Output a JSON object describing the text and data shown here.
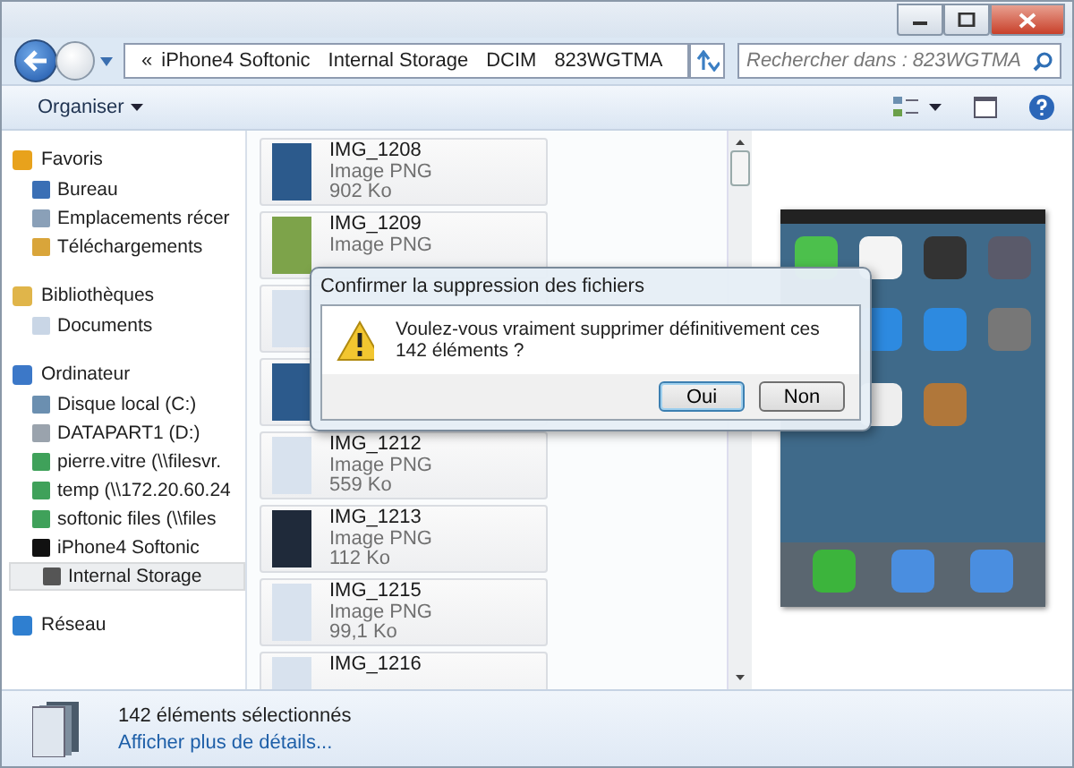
{
  "address_bar": {
    "overflow_marker": "«",
    "breadcrumb": [
      "iPhone4 Softonic",
      "Internal Storage",
      "DCIM",
      "823WGTMA"
    ]
  },
  "search": {
    "placeholder": "Rechercher dans : 823WGTMA"
  },
  "toolbar": {
    "organize": "Organiser"
  },
  "sidebar": {
    "groups": [
      {
        "label": "Favoris",
        "items": [
          {
            "label": "Bureau",
            "selected": false
          },
          {
            "label": "Emplacements récer",
            "selected": false
          },
          {
            "label": "Téléchargements",
            "selected": false
          }
        ]
      },
      {
        "label": "Bibliothèques",
        "items": [
          {
            "label": "Documents",
            "selected": false
          }
        ]
      },
      {
        "label": "Ordinateur",
        "items": [
          {
            "label": "Disque local (C:)",
            "selected": false
          },
          {
            "label": "DATAPART1 (D:)",
            "selected": false
          },
          {
            "label": "pierre.vitre (\\\\filesvr.",
            "selected": false
          },
          {
            "label": "temp (\\\\172.20.60.24",
            "selected": false
          },
          {
            "label": "softonic files (\\\\files",
            "selected": false
          },
          {
            "label": "iPhone4 Softonic",
            "selected": false,
            "children": [
              {
                "label": "Internal Storage",
                "selected": true
              }
            ]
          }
        ]
      },
      {
        "label": "Réseau"
      }
    ]
  },
  "files": [
    {
      "name": "IMG_1208",
      "type": "Image PNG",
      "size": "902 Ko"
    },
    {
      "name": "IMG_1209",
      "type": "Image PNG"
    },
    {
      "name": "IMG_1212",
      "type": "Image PNG",
      "size": "559 Ko"
    },
    {
      "name": "IMG_1213",
      "type": "Image PNG",
      "size": "112 Ko"
    },
    {
      "name": "IMG_1215",
      "type": "Image PNG",
      "size": "99,1 Ko"
    },
    {
      "name": "IMG_1216"
    }
  ],
  "dialog": {
    "title": "Confirmer la suppression des fichiers",
    "message": "Voulez-vous vraiment supprimer définitivement ces 142 éléments ?",
    "buttons": [
      {
        "label": "Oui",
        "default": true
      },
      {
        "label": "Non",
        "default": false
      }
    ]
  },
  "status_bar": {
    "summary": "142 éléments sélectionnés",
    "link": "Afficher plus de détails..."
  }
}
